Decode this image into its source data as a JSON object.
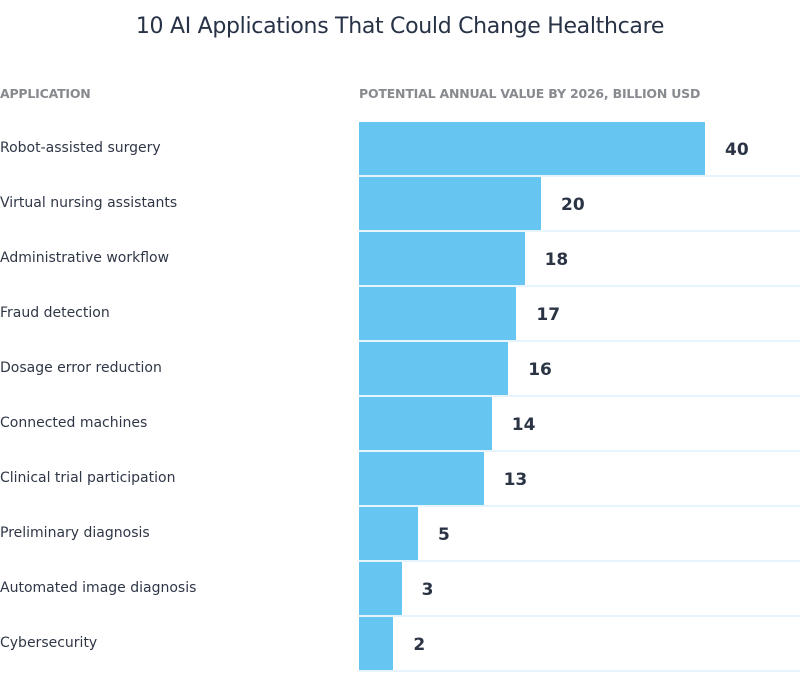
{
  "chart_data": {
    "type": "bar",
    "orientation": "horizontal",
    "title": "10 AI Applications That Could Change Healthcare",
    "xlabel": "POTENTIAL ANNUAL VALUE BY 2026, BILLION USD",
    "ylabel": "APPLICATION",
    "categories": [
      "Robot-assisted surgery",
      "Virtual nursing assistants",
      "Administrative workflow",
      "Fraud detection",
      "Dosage error reduction",
      "Connected machines",
      "Clinical trial participation",
      "Preliminary diagnosis",
      "Automated image diagnosis",
      "Cybersecurity"
    ],
    "values": [
      40,
      20,
      18,
      17,
      16,
      14,
      13,
      5,
      3,
      2
    ],
    "units": "billion USD",
    "grid": false,
    "legend": "none",
    "colors": {
      "bar": "#66c6f1",
      "separator": "#e6f5fd",
      "text": "#2b3445",
      "header": "#878a8f"
    }
  }
}
